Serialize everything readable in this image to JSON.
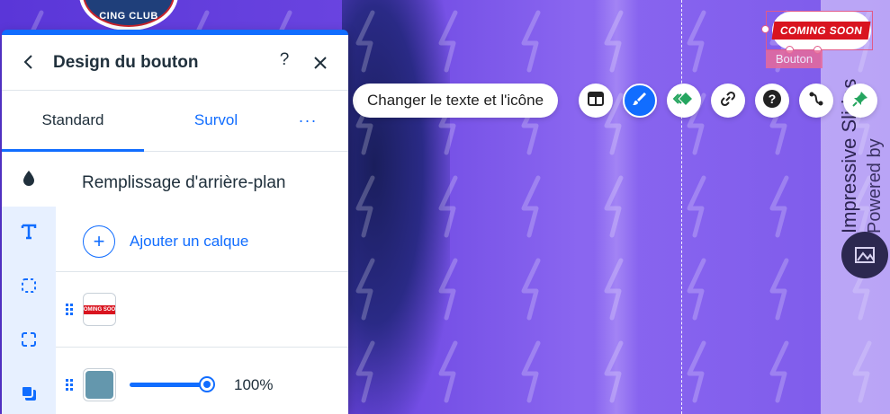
{
  "panel": {
    "title": "Design du bouton",
    "help_label": "?",
    "tabs": [
      {
        "label": "Standard",
        "active": true
      },
      {
        "label": "Survol",
        "active": false
      },
      {
        "label": "···",
        "active": false
      }
    ],
    "rail_icons": [
      "fill-drop-icon",
      "text-icon",
      "border-icon",
      "corners-icon",
      "shadow-icon"
    ],
    "section_title": "Remplissage d'arrière-plan",
    "add_layer_label": "Ajouter un calque",
    "add_layer_icon": "+",
    "layers": [
      {
        "type": "image",
        "thumb_text": "COMING SOON"
      },
      {
        "type": "color",
        "color": "#6497ad",
        "opacity": "100%"
      }
    ]
  },
  "toolbar": {
    "change_text_label": "Changer le texte et l'icône",
    "buttons": [
      "layout-icon",
      "design-brush-icon",
      "animation-icon",
      "link-icon",
      "help-icon",
      "connect-icon",
      "pin-icon"
    ]
  },
  "element": {
    "button_text": "COMING SOON",
    "label": "Bouton"
  },
  "canvas": {
    "badge_text": "CING CLUB",
    "vertical_text_1": "Impressive Slides",
    "vertical_text_2": "Powered by"
  },
  "colors": {
    "accent": "#116dff",
    "canvas_purple": "#7a55e6",
    "selection": "#e05a8a",
    "brand_red": "#d9141f"
  }
}
